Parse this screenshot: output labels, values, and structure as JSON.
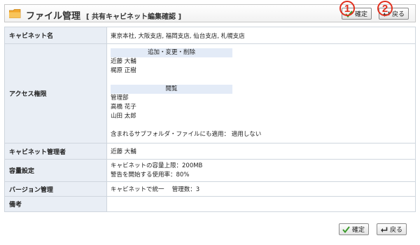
{
  "header": {
    "title": "ファイル管理",
    "subtitle": "[ 共有キャビネット編集確認 ]",
    "confirm_label": "確定",
    "back_label": "戻る"
  },
  "badges": {
    "one": "1",
    "two": "2"
  },
  "rows": {
    "cabinet_name": {
      "label": "キャビネット名",
      "value": "東京本社, 大阪支店, 福岡支店, 仙台支店, 札幌支店"
    },
    "access": {
      "label": "アクセス権限",
      "group1_header": "追加・変更・削除",
      "group1_users": [
        "近藤 大輔",
        "梶原 正樹"
      ],
      "group2_header": "閲覧",
      "group2_users": [
        "管理部",
        "高橋 花子",
        "山田 太郎"
      ],
      "subfolder_note": "含まれるサブフォルダ・ファイルにも適用： 適用しない"
    },
    "cabinet_admin": {
      "label": "キャビネット管理者",
      "value": "近藤 大輔"
    },
    "capacity": {
      "label": "容量設定",
      "limit": "キャビネットの容量上限：200MB",
      "warning": "警告を開始する使用率：80%"
    },
    "version": {
      "label": "バージョン管理",
      "value": "キャビネットで統一　 管理数：3"
    },
    "notes": {
      "label": "備考",
      "value": ""
    }
  },
  "footer": {
    "confirm_label": "確定",
    "back_label": "戻る"
  },
  "colors": {
    "header_cell_bg": "#e9eef5",
    "badge_red": "#e0301e",
    "check_green": "#3a9a2a",
    "folder_orange": "#f2a72c"
  }
}
